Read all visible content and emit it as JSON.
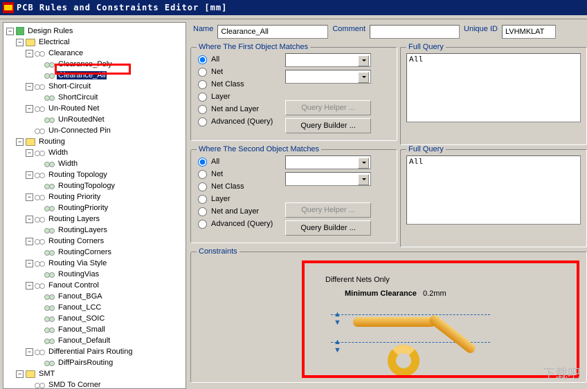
{
  "window": {
    "title": "PCB Rules and Constraints Editor [mm]"
  },
  "tree": {
    "root": "Design Rules",
    "electrical": "Electrical",
    "clearance": "Clearance",
    "clearance_poly": "Clearance_Poly",
    "clearance_all": "Clearance_All",
    "short_circuit": "Short-Circuit",
    "short_circuit_rule": "ShortCircuit",
    "unrouted": "Un-Routed Net",
    "unrouted_rule": "UnRoutedNet",
    "unconnected": "Un-Connected Pin",
    "routing": "Routing",
    "width": "Width",
    "width_rule": "Width",
    "rtopo": "Routing Topology",
    "rtopo_rule": "RoutingTopology",
    "rprio": "Routing Priority",
    "rprio_rule": "RoutingPriority",
    "rlayers": "Routing Layers",
    "rlayers_rule": "RoutingLayers",
    "rcorners": "Routing Corners",
    "rcorners_rule": "RoutingCorners",
    "rvias": "Routing Via Style",
    "rvias_rule": "RoutingVias",
    "fanout": "Fanout Control",
    "fanout_bga": "Fanout_BGA",
    "fanout_lcc": "Fanout_LCC",
    "fanout_soic": "Fanout_SOIC",
    "fanout_small": "Fanout_Small",
    "fanout_default": "Fanout_Default",
    "diffpairs": "Differential Pairs Routing",
    "diffpairs_rule": "DiffPairsRouting",
    "smt": "SMT",
    "smd_corner": "SMD To Corner"
  },
  "header": {
    "name_label": "Name",
    "name_value": "Clearance_All",
    "comment_label": "Comment",
    "comment_value": "",
    "uniqueid_label": "Unique ID",
    "uniqueid_value": "LVHMKLAT"
  },
  "match1": {
    "legend": "Where The First Object Matches",
    "opt_all": "All",
    "opt_net": "Net",
    "opt_netclass": "Net Class",
    "opt_layer": "Layer",
    "opt_netlayer": "Net and Layer",
    "opt_advanced": "Advanced (Query)",
    "btn_helper": "Query Helper ...",
    "btn_builder": "Query Builder ...",
    "fullquery_label": "Full Query",
    "fullquery_value": "All"
  },
  "match2": {
    "legend": "Where The Second Object Matches",
    "fullquery_label": "Full Query",
    "fullquery_value": "All"
  },
  "constraints": {
    "legend": "Constraints",
    "diffnets": "Different Nets Only",
    "minclear_label": "Minimum Clearance",
    "minclear_value": "0.2mm"
  },
  "watermark": "下载吧"
}
